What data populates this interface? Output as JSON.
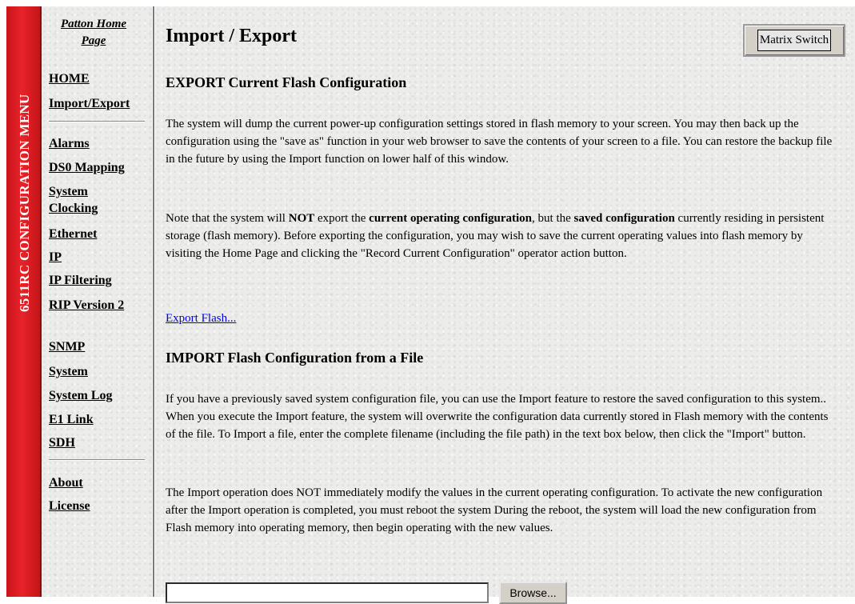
{
  "sidebar": {
    "vertical_title": "6511RC CONFIGURATION MENU",
    "home_page_link": "Patton Home Page",
    "links_group1": [
      "HOME",
      "Import/Export"
    ],
    "links_group2": [
      "Alarms",
      "DS0 Mapping",
      "System Clocking",
      "Ethernet",
      "IP",
      "IP Filtering",
      "RIP Version 2",
      "SNMP",
      "System",
      "System Log",
      "E1 Link",
      "SDH"
    ],
    "links_group3": [
      "About",
      "License"
    ]
  },
  "main": {
    "title": "Import / Export",
    "matrix_button": "Matrix Switch",
    "export": {
      "heading": "EXPORT Current Flash Configuration",
      "para1": "The system will dump the current power-up configuration settings stored in flash memory to your screen. You may then back up the configuration using the \"save as\" function in your web browser to save the contents of your screen to a file. You can restore the backup file in the future by using the Import function on lower half of this window.",
      "para2_a": "Note that the system will ",
      "para2_not": "NOT",
      "para2_b": " export the ",
      "para2_current": "current operating configuration",
      "para2_c": ", but the ",
      "para2_saved": "saved configuration",
      "para2_d": " currently residing in persistent storage (flash memory). Before exporting the configuration, you may wish to save the current operating values into flash memory by visiting the Home Page and clicking the \"Record Current Configuration\" operator action button.",
      "link": "Export Flash..."
    },
    "import": {
      "heading": "IMPORT Flash Configuration from a File",
      "para1": "If you have a previously saved system configuration file, you can use the Import feature to restore the saved configuration to this system.. When you execute the Import feature, the system will overwrite the configuration data currently stored in Flash memory with the contents of the file. To Import a file, enter the complete filename (including the file path) in the text box below, then click the \"Import\" button.",
      "para2": "The Import operation does NOT immediately modify the values in the current operating configuration. To activate the new configuration after the Import operation is completed, you must reboot the system During the reboot, the system will load the new configuration from Flash memory into operating memory, then begin operating with the new values.",
      "file_value": "",
      "browse_label": "Browse..."
    }
  },
  "colors": {
    "sidebar_red": "#e8232a",
    "link_blue": "#0000ee",
    "background": "#ececea"
  }
}
